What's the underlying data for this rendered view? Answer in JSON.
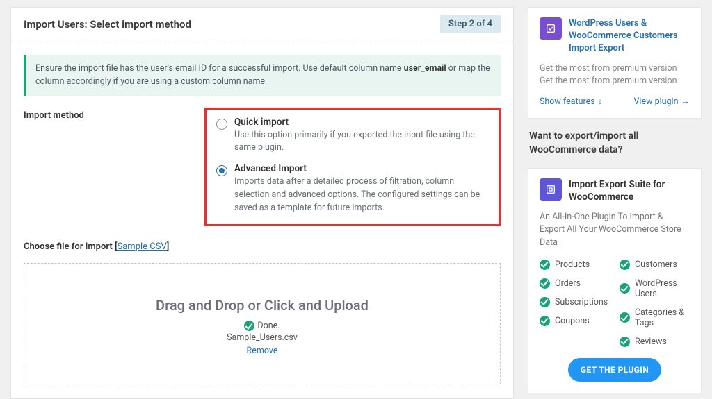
{
  "header": {
    "title": "Import Users: Select import method",
    "step": "Step 2 of 4"
  },
  "notice": {
    "pre": "Ensure the import file has the user's email ID for a successful import. Use default column name ",
    "bold": "user_email",
    "post": " or map the column accordingly if you are using a custom column name."
  },
  "method": {
    "label": "Import method",
    "quick": {
      "title": "Quick import",
      "desc": "Use this option primarily if you exported the input file using the same plugin."
    },
    "advanced": {
      "title": "Advanced Import",
      "desc": "Imports data after a detailed process of filtration, column selection and advanced options. The configured settings can be saved as a template for future imports."
    }
  },
  "choose": {
    "label": "Choose file for Import ",
    "sample": "Sample CSV"
  },
  "dropzone": {
    "title": "Drag and Drop or Click and Upload",
    "done": "Done.",
    "file": "Sample_Users.csv",
    "remove": "Remove"
  },
  "sidebar": {
    "card1": {
      "title": "WordPress Users & WooCommerce Customers Import Export",
      "desc": "Get the most from premium version Get the most from premium version",
      "show_features": "Show features",
      "view_plugin": "View plugin"
    },
    "section_title": "Want to export/import all WooCommerce data?",
    "card2": {
      "title": "Import Export Suite for WooCommerce",
      "desc": "An All-In-One Plugin To Import & Export All Your WooCommerce Store Data",
      "features_left": [
        "Products",
        "Orders",
        "Subscriptions",
        "Coupons"
      ],
      "features_right": [
        "Customers",
        "WordPress Users",
        "Categories & Tags",
        "Reviews"
      ],
      "cta": "GET THE PLUGIN"
    }
  }
}
